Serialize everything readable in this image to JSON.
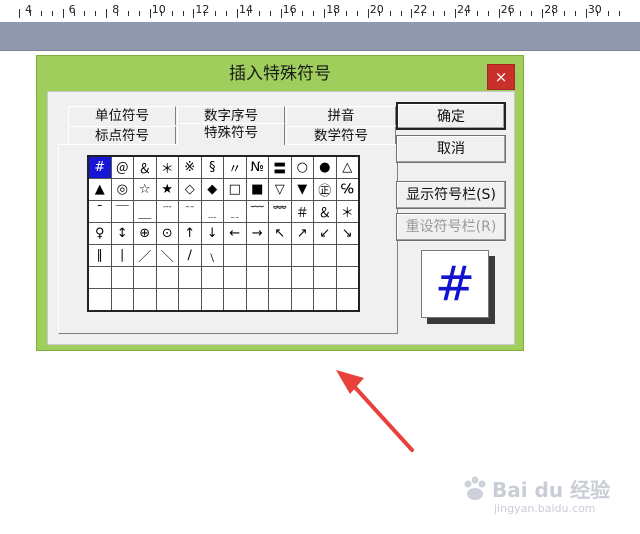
{
  "ruler": {
    "labels": [
      "4",
      "6",
      "8",
      "10",
      "12",
      "14",
      "16",
      "18",
      "20",
      "22",
      "24",
      "26",
      "28",
      "30"
    ]
  },
  "dialog": {
    "title": "插入特殊符号",
    "close_glyph": "×",
    "tabs": [
      {
        "label": "单位符号"
      },
      {
        "label": "数字序号"
      },
      {
        "label": "拼音"
      },
      {
        "label": "标点符号"
      },
      {
        "label": "特殊符号",
        "active": true
      },
      {
        "label": "数学符号"
      }
    ],
    "grid_rows": [
      [
        "#",
        "＠",
        "＆",
        "＊",
        "※",
        "§",
        "〃",
        "№",
        "〓",
        "○",
        "●",
        "△"
      ],
      [
        "▲",
        "◎",
        "☆",
        "★",
        "◇",
        "◆",
        "□",
        "■",
        "▽",
        "▼",
        "㊣",
        "℅"
      ],
      [
        "ˉ",
        "￣",
        "＿",
        "﹉",
        "﹊",
        "﹍",
        "﹎",
        "﹋",
        "﹌",
        "＃",
        "＆",
        "＊"
      ],
      [
        "♀",
        "↕",
        "⊕",
        "⊙",
        "↑",
        "↓",
        "←",
        "→",
        "↖",
        "↗",
        "↙",
        "↘"
      ],
      [
        "∥",
        "∣",
        "／",
        "＼",
        "∕",
        "﹨",
        "",
        "",
        "",
        "",
        "",
        ""
      ],
      [
        "",
        "",
        "",
        "",
        "",
        "",
        "",
        "",
        "",
        "",
        "",
        ""
      ],
      [
        "",
        "",
        "",
        "",
        "",
        "",
        "",
        "",
        "",
        "",
        "",
        ""
      ]
    ],
    "buttons": {
      "ok": "确定",
      "cancel": "取消",
      "show_bar": "显示符号栏(S)",
      "reset_bar": "重设符号栏(R)"
    },
    "preview_symbol": "#",
    "selected_symbol": "#"
  },
  "watermark": {
    "brand": "Bai du 经验",
    "sub": "jingyan.baidu.com"
  },
  "colors": {
    "dialog_frame": "#9fce5d",
    "close": "#c9302c",
    "selection": "#1616d4",
    "arrow": "#e8413c"
  }
}
